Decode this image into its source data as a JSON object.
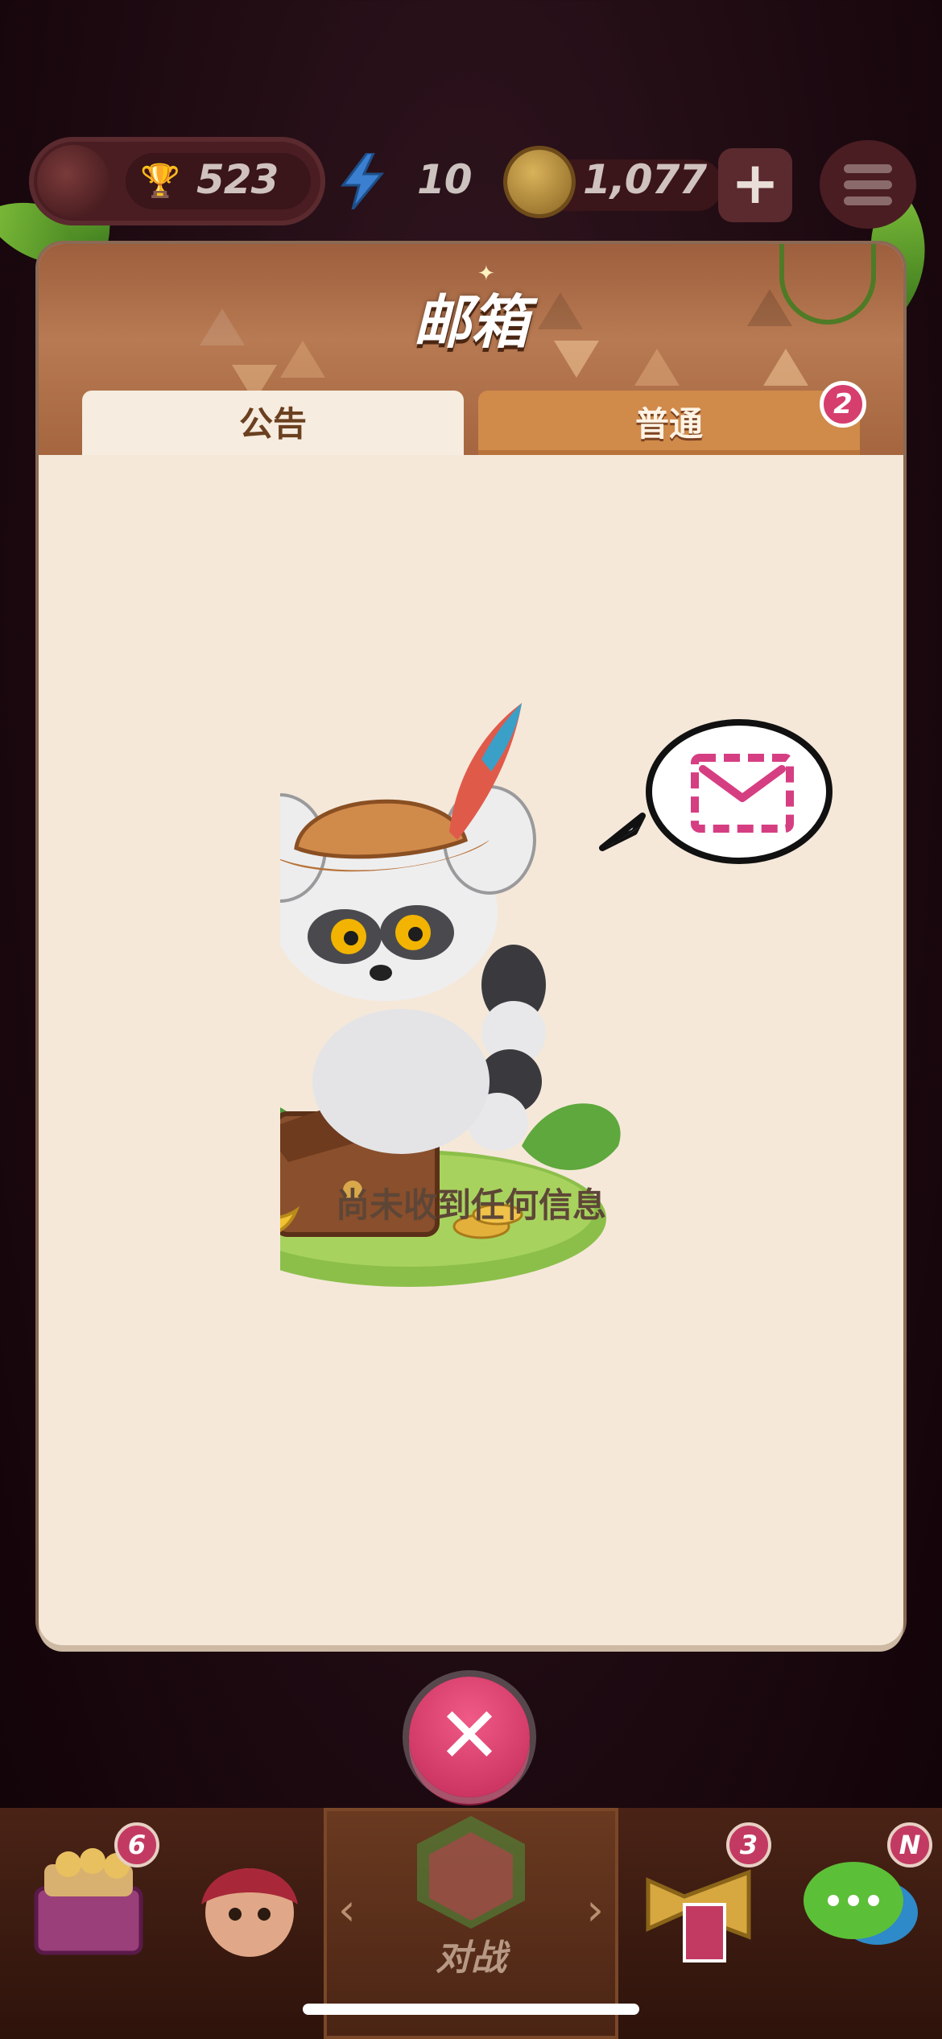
{
  "hud": {
    "trophies": "523",
    "energy": "10",
    "coins": "1,077",
    "plus_label": "+"
  },
  "modal": {
    "title": "邮箱",
    "tabs": [
      {
        "label": "公告",
        "active": true
      },
      {
        "label": "普通",
        "active": false,
        "badge": "2"
      }
    ],
    "empty_message": "尚未收到任何信息"
  },
  "close_label": "✕",
  "bottom_nav": {
    "shop_badge": "6",
    "battle_label": "对战",
    "events_badge": "3",
    "social_badge": "N"
  },
  "colors": {
    "accent_pink": "#d63e6e",
    "header_brown": "#a5663f",
    "panel_cream": "#f5e8d9"
  }
}
